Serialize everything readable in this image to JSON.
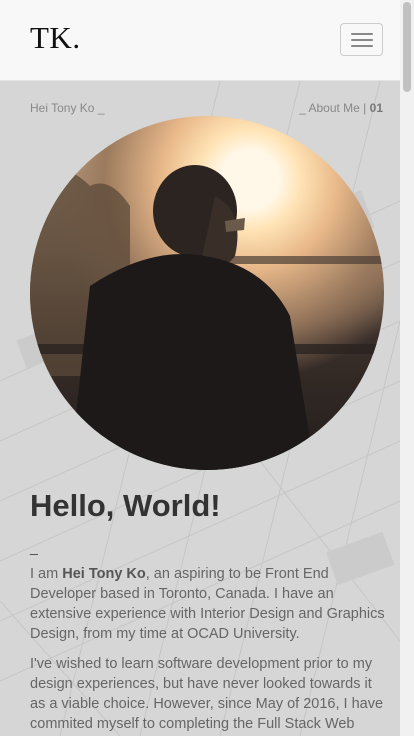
{
  "navbar": {
    "brand": "TK.",
    "toggle_icon": "hamburger-icon"
  },
  "breadcrumb": {
    "left": "Hei Tony Ko _",
    "right_prefix": "_ About Me | ",
    "right_number": "01"
  },
  "hero": {
    "image_alt": "Portrait of Hei Tony Ko at sunset",
    "title": "Hello, World!",
    "divider": "_"
  },
  "about": {
    "p1_prefix": "I am ",
    "p1_name": "Hei Tony Ko",
    "p1_rest": ", an aspiring to be Front End Developer based in Toronto, Canada. I have an extensive experience with Interior Design and Graphics Design, from my time at OCAD University.",
    "p2": "I've wished to learn software development prior to my design experiences, but have never looked towards it as a viable choice. However, since May of 2016, I have commited myself to completing the Full Stack Web"
  }
}
